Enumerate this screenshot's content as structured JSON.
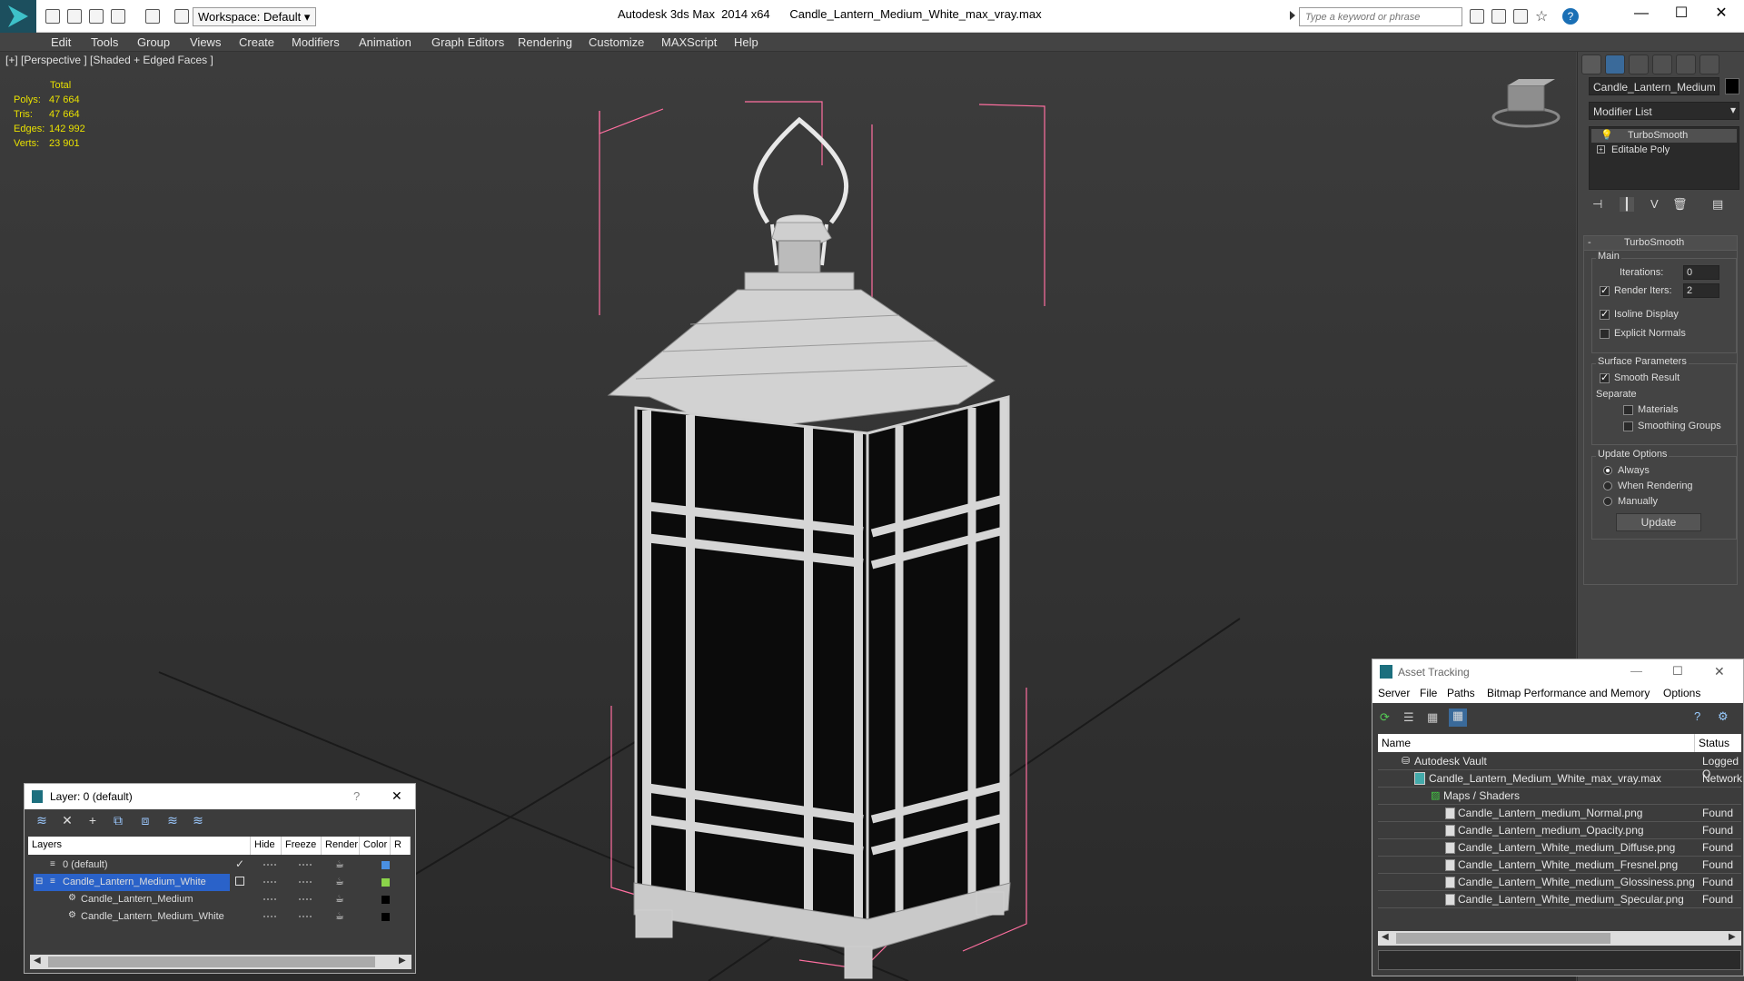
{
  "title_bar": {
    "app_title": "Autodesk 3ds Max  2014 x64",
    "file_name": "Candle_Lantern_Medium_White_max_vray.max",
    "workspace_label": "Workspace: Default",
    "search_placeholder": "Type a keyword or phrase",
    "minimize": "—",
    "maximize": "☐",
    "close": "✕"
  },
  "menu": [
    "Edit",
    "Tools",
    "Group",
    "Views",
    "Create",
    "Modifiers",
    "Animation",
    "Graph Editors",
    "Rendering",
    "Customize",
    "MAXScript",
    "Help"
  ],
  "viewport": {
    "label": "[+] [Perspective ] [Shaded + Edged Faces ]",
    "stats": {
      "header": "Total",
      "rows": [
        {
          "label": "Polys:",
          "value": "47 664"
        },
        {
          "label": "Tris:",
          "value": "47 664"
        },
        {
          "label": "Edges:",
          "value": "142 992"
        },
        {
          "label": "Verts:",
          "value": "23 901"
        }
      ]
    }
  },
  "command_panel": {
    "object_name": "Candle_Lantern_Medium",
    "modifier_list": "Modifier List",
    "stack": [
      "TurboSmooth",
      "Editable Poly"
    ],
    "turbosmooth": {
      "title": "TurboSmooth",
      "main_label": "Main",
      "iterations_label": "Iterations:",
      "iterations_value": "0",
      "render_iters_label": "Render Iters:",
      "render_iters_value": "2",
      "isoline_label": "Isoline Display",
      "explicit_label": "Explicit Normals",
      "surface_label": "Surface Parameters",
      "smooth_label": "Smooth Result",
      "separate_label": "Separate",
      "materials_label": "Materials",
      "smoothing_groups_label": "Smoothing Groups",
      "update_options_label": "Update Options",
      "always_label": "Always",
      "when_rendering_label": "When Rendering",
      "manually_label": "Manually",
      "update_button": "Update"
    }
  },
  "layer_window": {
    "title": "Layer: 0 (default)",
    "help": "?",
    "close": "✕",
    "columns": [
      "Layers",
      "Hide",
      "Freeze",
      "Render",
      "Color",
      "R"
    ],
    "rows": [
      {
        "name": "0 (default)",
        "color": "#4a90e2"
      },
      {
        "name": "Candle_Lantern_Medium_White",
        "color": "#8bd44a"
      },
      {
        "name": "Candle_Lantern_Medium",
        "color": "#000000"
      },
      {
        "name": "Candle_Lantern_Medium_White",
        "color": "#000000"
      }
    ]
  },
  "asset_tracking": {
    "title": "Asset Tracking",
    "minimize": "—",
    "maximize": "☐",
    "close": "✕",
    "menu": [
      "Server",
      "File",
      "Paths",
      "Bitmap Performance and Memory",
      "Options"
    ],
    "columns": [
      "Name",
      "Status"
    ],
    "rows": [
      {
        "name": "Autodesk Vault",
        "status": "Logged O"
      },
      {
        "name": "Candle_Lantern_Medium_White_max_vray.max",
        "status": "Network"
      },
      {
        "name": "Maps / Shaders",
        "status": ""
      },
      {
        "name": "Candle_Lantern_medium_Normal.png",
        "status": "Found"
      },
      {
        "name": "Candle_Lantern_medium_Opacity.png",
        "status": "Found"
      },
      {
        "name": "Candle_Lantern_White_medium_Diffuse.png",
        "status": "Found"
      },
      {
        "name": "Candle_Lantern_White_medium_Fresnel.png",
        "status": "Found"
      },
      {
        "name": "Candle_Lantern_White_medium_Glossiness.png",
        "status": "Found"
      },
      {
        "name": "Candle_Lantern_White_medium_Specular.png",
        "status": "Found"
      }
    ]
  }
}
